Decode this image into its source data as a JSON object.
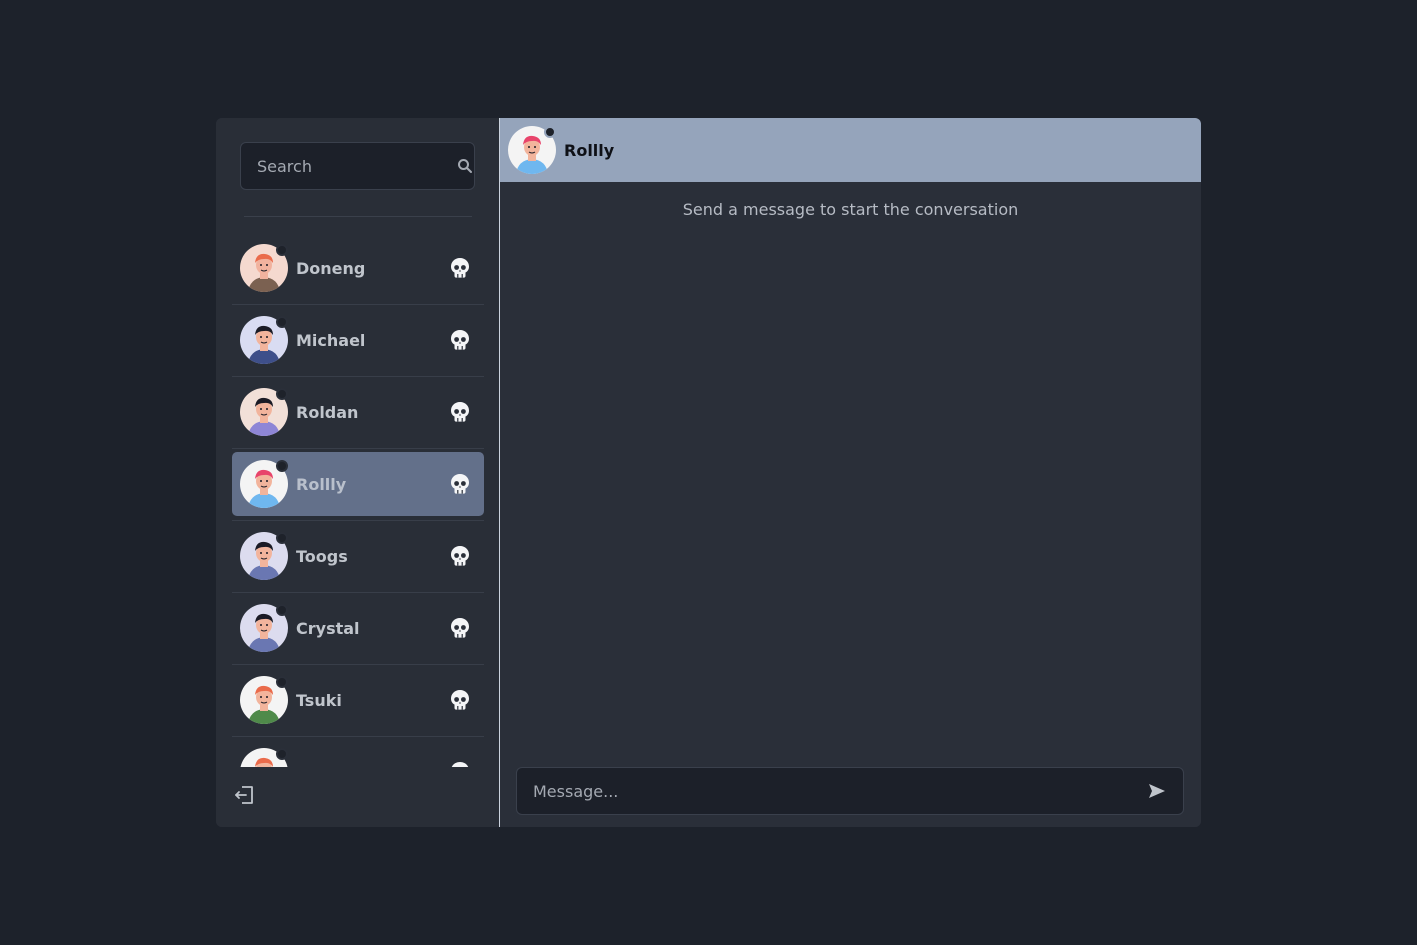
{
  "search": {
    "placeholder": "Search"
  },
  "contacts": [
    {
      "name": "Doneng",
      "avatar": "doneng-avatar",
      "skin": "#f1b29e",
      "hair": "#ea6b4b",
      "shirt": "#7b6151",
      "bg": "#f5d9cf"
    },
    {
      "name": "Michael",
      "avatar": "michael-avatar",
      "skin": "#f2b49c",
      "hair": "#1b1b25",
      "shirt": "#3e4f8a",
      "bg": "#d9dcf2"
    },
    {
      "name": "Roldan",
      "avatar": "roldan-avatar",
      "skin": "#f2b49c",
      "hair": "#1b1b25",
      "shirt": "#8e86d6",
      "bg": "#f2e0d8"
    },
    {
      "name": "Rollly",
      "avatar": "rollly-avatar",
      "skin": "#f2b49c",
      "hair": "#e8446b",
      "shirt": "#6fb7ef",
      "bg": "#f4f4f4"
    },
    {
      "name": "Toogs",
      "avatar": "toogs-avatar",
      "skin": "#f2b49c",
      "hair": "#1b1b25",
      "shirt": "#6a77b2",
      "bg": "#dcdcef"
    },
    {
      "name": "Crystal",
      "avatar": "crystal-avatar",
      "skin": "#f2b49c",
      "hair": "#1b1b25",
      "shirt": "#6a77b2",
      "bg": "#dcdcef"
    },
    {
      "name": "Tsuki",
      "avatar": "tsuki-avatar",
      "skin": "#f2b49c",
      "hair": "#ea6b4b",
      "shirt": "#4f8a4a",
      "bg": "#f4f4f4"
    },
    {
      "name": "",
      "avatar": "partial-avatar",
      "skin": "#f2b49c",
      "hair": "#ea6b4b",
      "shirt": "#7b6151",
      "bg": "#f4f4f4"
    }
  ],
  "active_contact_index": 3,
  "chat": {
    "title": "Rollly",
    "empty_message": "Send a message to start the conversation",
    "composer_placeholder": "Message..."
  },
  "colors": {
    "background": "#1d222b",
    "panel": "#2a2f39",
    "header": "#95a4bb",
    "active_item": "#63708a",
    "input_bg": "#1c2029"
  },
  "icons": {
    "search": "search-icon",
    "delete": "skull-icon",
    "logout": "logout-icon",
    "send": "send-icon"
  }
}
